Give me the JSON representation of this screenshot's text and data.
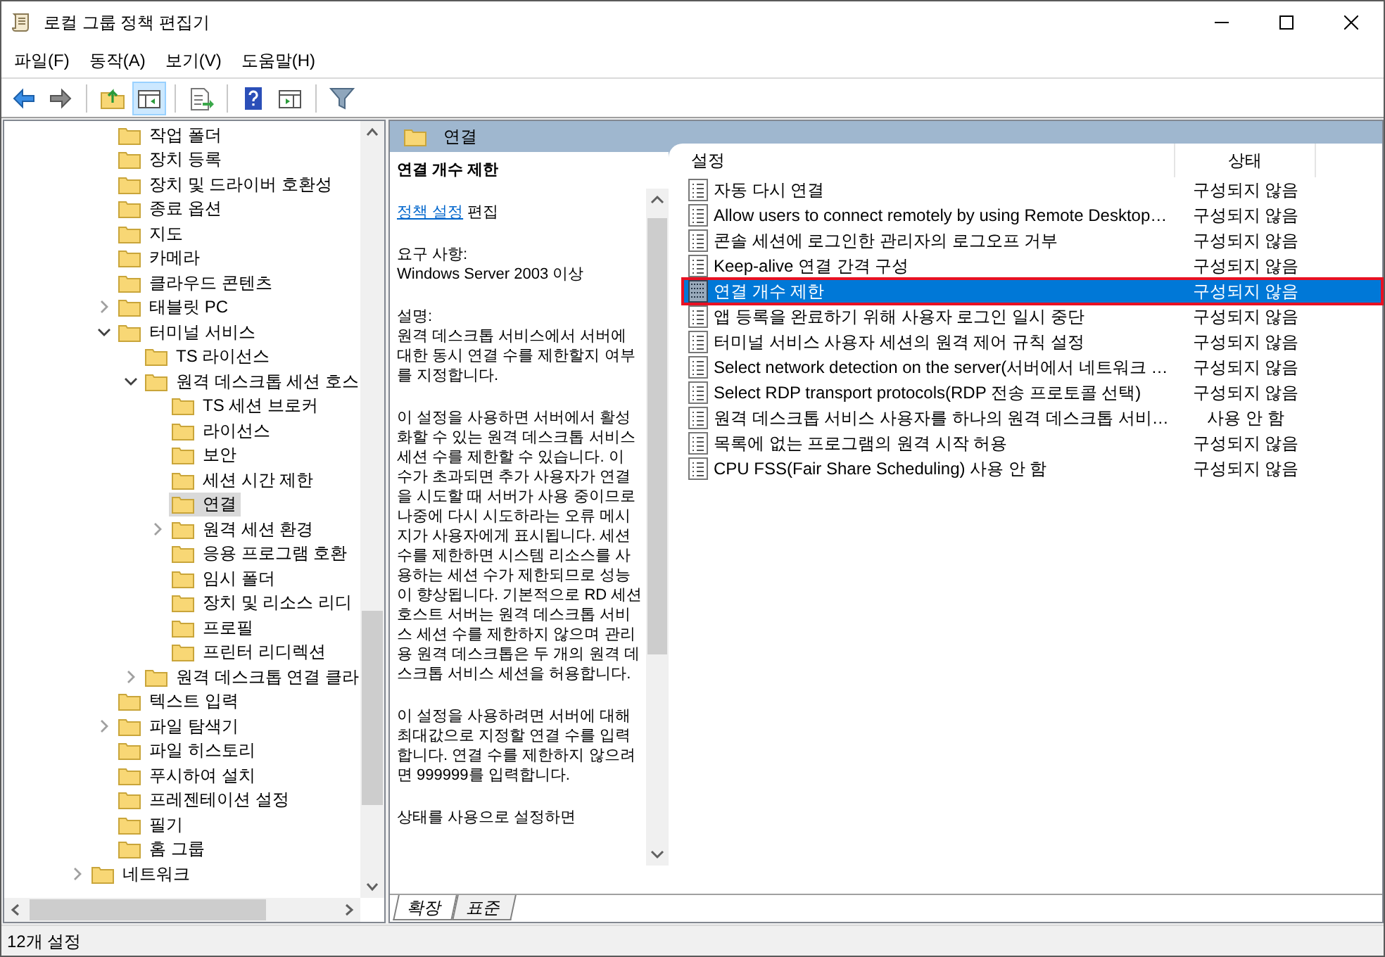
{
  "window": {
    "title": "로컬 그룹 정책 편집기"
  },
  "menu": [
    {
      "label": "파일(F)"
    },
    {
      "label": "동작(A)"
    },
    {
      "label": "보기(V)"
    },
    {
      "label": "도움말(H)"
    }
  ],
  "toolbar": [
    {
      "kind": "back",
      "pressed": false
    },
    {
      "kind": "forward",
      "pressed": false
    },
    {
      "kind": "sep"
    },
    {
      "kind": "up",
      "pressed": false
    },
    {
      "kind": "tree",
      "pressed": true
    },
    {
      "kind": "sep"
    },
    {
      "kind": "export",
      "pressed": false
    },
    {
      "kind": "sep"
    },
    {
      "kind": "help",
      "pressed": false
    },
    {
      "kind": "pane",
      "pressed": false
    },
    {
      "kind": "sep"
    },
    {
      "kind": "filter",
      "pressed": false
    }
  ],
  "tree_items": [
    {
      "label": "작업 폴더",
      "has_children": false,
      "expanded": false,
      "selected": false
    },
    {
      "label": "장치 등록",
      "has_children": false,
      "expanded": false,
      "selected": false
    },
    {
      "label": "장치 및 드라이버 호환성",
      "has_children": false,
      "expanded": false,
      "selected": false
    },
    {
      "label": "종료 옵션",
      "has_children": false,
      "expanded": false,
      "selected": false
    },
    {
      "label": "지도",
      "has_children": false,
      "expanded": false,
      "selected": false
    },
    {
      "label": "카메라",
      "has_children": false,
      "expanded": false,
      "selected": false
    },
    {
      "label": "클라우드 콘텐츠",
      "has_children": false,
      "expanded": false,
      "selected": false
    },
    {
      "label": "태블릿 PC",
      "has_children": true,
      "expanded": false,
      "selected": false
    },
    {
      "label": "터미널 서비스",
      "has_children": true,
      "expanded": true,
      "selected": false,
      "children": [
        {
          "label": "TS 라이선스",
          "has_children": false,
          "expanded": false,
          "selected": false
        },
        {
          "label": "원격 데스크톱 세션 호스",
          "has_children": true,
          "expanded": true,
          "selected": false,
          "children": [
            {
              "label": "TS 세션 브로커",
              "has_children": false,
              "expanded": false,
              "selected": false
            },
            {
              "label": "라이선스",
              "has_children": false,
              "expanded": false,
              "selected": false
            },
            {
              "label": "보안",
              "has_children": false,
              "expanded": false,
              "selected": false
            },
            {
              "label": "세션 시간 제한",
              "has_children": false,
              "expanded": false,
              "selected": false
            },
            {
              "label": "연결",
              "has_children": false,
              "expanded": false,
              "selected": true
            },
            {
              "label": "원격 세션 환경",
              "has_children": true,
              "expanded": false,
              "selected": false
            },
            {
              "label": "응용 프로그램 호환",
              "has_children": false,
              "expanded": false,
              "selected": false
            },
            {
              "label": "임시 폴더",
              "has_children": false,
              "expanded": false,
              "selected": false
            },
            {
              "label": "장치 및 리소스 리디",
              "has_children": false,
              "expanded": false,
              "selected": false
            },
            {
              "label": "프로필",
              "has_children": false,
              "expanded": false,
              "selected": false
            },
            {
              "label": "프린터 리디렉션",
              "has_children": false,
              "expanded": false,
              "selected": false
            }
          ]
        },
        {
          "label": "원격 데스크톱 연결 클라",
          "has_children": true,
          "expanded": false,
          "selected": false
        }
      ]
    },
    {
      "label": "텍스트 입력",
      "has_children": false,
      "expanded": false,
      "selected": false
    },
    {
      "label": "파일 탐색기",
      "has_children": true,
      "expanded": false,
      "selected": false
    },
    {
      "label": "파일 히스토리",
      "has_children": false,
      "expanded": false,
      "selected": false
    },
    {
      "label": "푸시하여 설치",
      "has_children": false,
      "expanded": false,
      "selected": false
    },
    {
      "label": "프레젠테이션 설정",
      "has_children": false,
      "expanded": false,
      "selected": false
    },
    {
      "label": "필기",
      "has_children": false,
      "expanded": false,
      "selected": false
    },
    {
      "label": "홈 그룹",
      "has_children": false,
      "expanded": false,
      "selected": false
    }
  ],
  "tree_outer_items": [
    {
      "label": "네트워크",
      "has_children": true,
      "expanded": false,
      "selected": false
    }
  ],
  "folder_header": {
    "title": "연결"
  },
  "description": {
    "title": "연결 개수 제한",
    "link": "정책 설정",
    "link_suffix": " 편집",
    "requirements_label": "요구 사항:",
    "requirements": "Windows Server 2003 이상",
    "description_label": "설명:",
    "paragraphs": [
      "원격 데스크톱 서비스에서 서버에 대한 동시 연결 수를 제한할지 여부를 지정합니다.",
      "이 설정을 사용하면 서버에서 활성화할 수 있는 원격 데스크톱 서비스 세션 수를 제한할 수 있습니다. 이 수가 초과되면 추가 사용자가 연결을 시도할 때 서버가 사용 중이므로 나중에 다시 시도하라는 오류 메시지가 사용자에게 표시됩니다. 세션 수를 제한하면 시스템 리소스를 사용하는 세션 수가 제한되므로 성능이 향상됩니다. 기본적으로 RD 세션 호스트 서버는 원격 데스크톱 서비스 세션 수를 제한하지 않으며 관리용 원격 데스크톱은 두 개의 원격 데스크톱 서비스 세션을 허용합니다.",
      "이 설정을 사용하려면 서버에 대해 최대값으로 지정할 연결 수를 입력합니다. 연결 수를 제한하지 않으려면 999999를 입력합니다.",
      "상태를 사용으로 설정하면"
    ]
  },
  "view_tabs": [
    {
      "label": "확장",
      "selected": true
    },
    {
      "label": "표준",
      "selected": false
    }
  ],
  "settings_table": {
    "columns": [
      "설정",
      "상태"
    ],
    "rows": [
      {
        "name": "자동 다시 연결",
        "state": "구성되지 않음",
        "selected": false
      },
      {
        "name": "Allow users to connect remotely by using Remote Desktop…",
        "state": "구성되지 않음",
        "selected": false
      },
      {
        "name": "콘솔 세션에 로그인한 관리자의 로그오프 거부",
        "state": "구성되지 않음",
        "selected": false
      },
      {
        "name": "Keep-alive 연결 간격 구성",
        "state": "구성되지 않음",
        "selected": false
      },
      {
        "name": "연결 개수 제한",
        "state": "구성되지 않음",
        "selected": true
      },
      {
        "name": "앱 등록을 완료하기 위해 사용자 로그인 일시 중단",
        "state": "구성되지 않음",
        "selected": false
      },
      {
        "name": "터미널 서비스 사용자 세션의 원격 제어 규칙 설정",
        "state": "구성되지 않음",
        "selected": false
      },
      {
        "name": "Select network detection on the server(서버에서 네트워크 …",
        "state": "구성되지 않음",
        "selected": false
      },
      {
        "name": "Select RDP transport protocols(RDP 전송 프로토콜 선택)",
        "state": "구성되지 않음",
        "selected": false
      },
      {
        "name": "원격 데스크톱 서비스 사용자를 하나의 원격 데스크톱 서비…",
        "state": "사용 안 함",
        "selected": false
      },
      {
        "name": "목록에 없는 프로그램의 원격 시작 허용",
        "state": "구성되지 않음",
        "selected": false
      },
      {
        "name": "CPU FSS(Fair Share Scheduling) 사용 안 함",
        "state": "구성되지 않음",
        "selected": false
      }
    ]
  },
  "status_bar": {
    "text": "12개 설정"
  }
}
